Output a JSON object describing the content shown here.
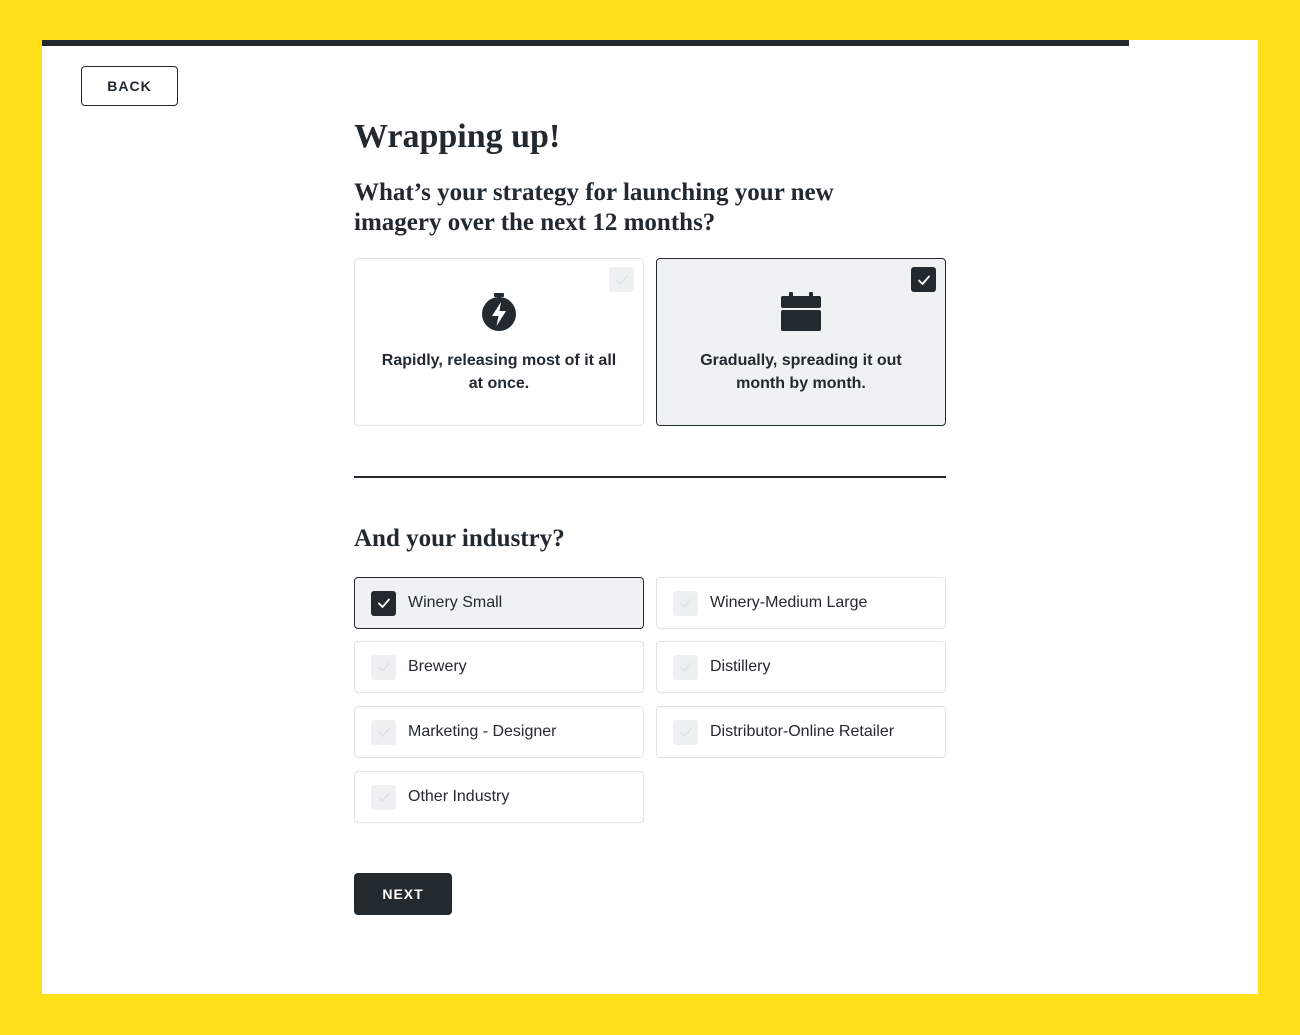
{
  "progress": {
    "fraction": 0.894
  },
  "nav": {
    "back_label": "BACK",
    "next_label": "NEXT"
  },
  "page": {
    "title": "Wrapping up!",
    "question": "What’s your strategy for launching your new imagery over the next 12 months?",
    "industry_question": "And your industry?"
  },
  "strategy": {
    "options": [
      {
        "label": "Rapidly, releasing most of it all at once.",
        "icon": "stopwatch-icon",
        "selected": false
      },
      {
        "label": "Gradually, spreading it out month by month.",
        "icon": "calendar-icon",
        "selected": true
      }
    ]
  },
  "industry": {
    "options": [
      {
        "label": "Winery Small",
        "selected": true
      },
      {
        "label": "Winery-Medium Large",
        "selected": false
      },
      {
        "label": "Brewery",
        "selected": false
      },
      {
        "label": "Distillery",
        "selected": false
      },
      {
        "label": "Marketing - Designer",
        "selected": false
      },
      {
        "label": "Distributor-Online Retailer",
        "selected": false
      },
      {
        "label": "Other Industry",
        "selected": false
      }
    ]
  },
  "colors": {
    "background": "#FFE01B",
    "dark": "#222a30",
    "selected_fill": "#eff2f2",
    "unchecked_box": "#eef1f2"
  }
}
